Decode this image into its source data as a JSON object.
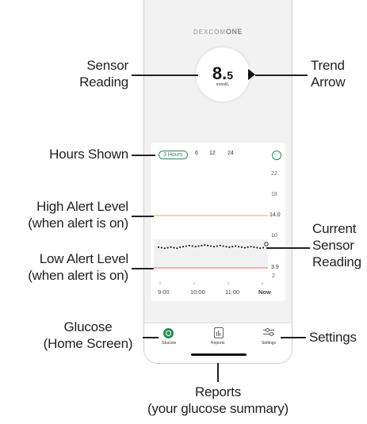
{
  "app": {
    "brand_prefix": "DEXCOM",
    "brand_suffix": "ONE"
  },
  "sensor": {
    "value_main": "8.",
    "value_decimal": "5",
    "unit": "mmol/L"
  },
  "chart_data": {
    "type": "scatter",
    "title": "",
    "hours_options": [
      "3 Hours",
      "6",
      "12",
      "24"
    ],
    "selected_hours": "3 Hours",
    "y_ticks": [
      "22",
      "18",
      "14.0",
      "10",
      "3.9",
      "2"
    ],
    "x_ticks": [
      "9:00",
      "10:00",
      "11:00",
      "Now"
    ],
    "high_alert": 14.0,
    "low_alert": 3.9,
    "high_color": "#f0c060",
    "low_color": "#f08080",
    "series": [
      {
        "values": [
          7.9,
          7.8,
          7.7,
          7.8,
          7.9,
          7.8,
          7.7,
          7.9,
          8.0,
          8.1,
          8.2,
          8.1,
          8.0,
          8.1,
          8.2,
          8.3,
          8.2,
          8.1,
          8.0,
          8.1,
          8.2,
          8.1,
          8.0,
          7.9,
          8.0,
          8.1,
          8.0,
          7.9,
          7.8,
          7.9,
          8.0,
          7.9,
          7.8,
          7.7,
          7.8,
          8.5
        ]
      }
    ]
  },
  "nav": {
    "glucose": "Glucose",
    "reports": "Reports",
    "settings": "Settings"
  },
  "callouts": {
    "sensor_reading": [
      "Sensor",
      "Reading"
    ],
    "trend_arrow": [
      "Trend",
      "Arrow"
    ],
    "hours_shown": "Hours Shown",
    "high_alert": [
      "High Alert Level",
      "(when alert is on)"
    ],
    "low_alert": [
      "Low Alert Level",
      "(when alert is on)"
    ],
    "current": [
      "Current",
      "Sensor",
      "Reading"
    ],
    "glucose": [
      "Glucose",
      "(Home Screen)"
    ],
    "settings": "Settings",
    "reports": [
      "Reports",
      "(your glucose summary)"
    ]
  }
}
